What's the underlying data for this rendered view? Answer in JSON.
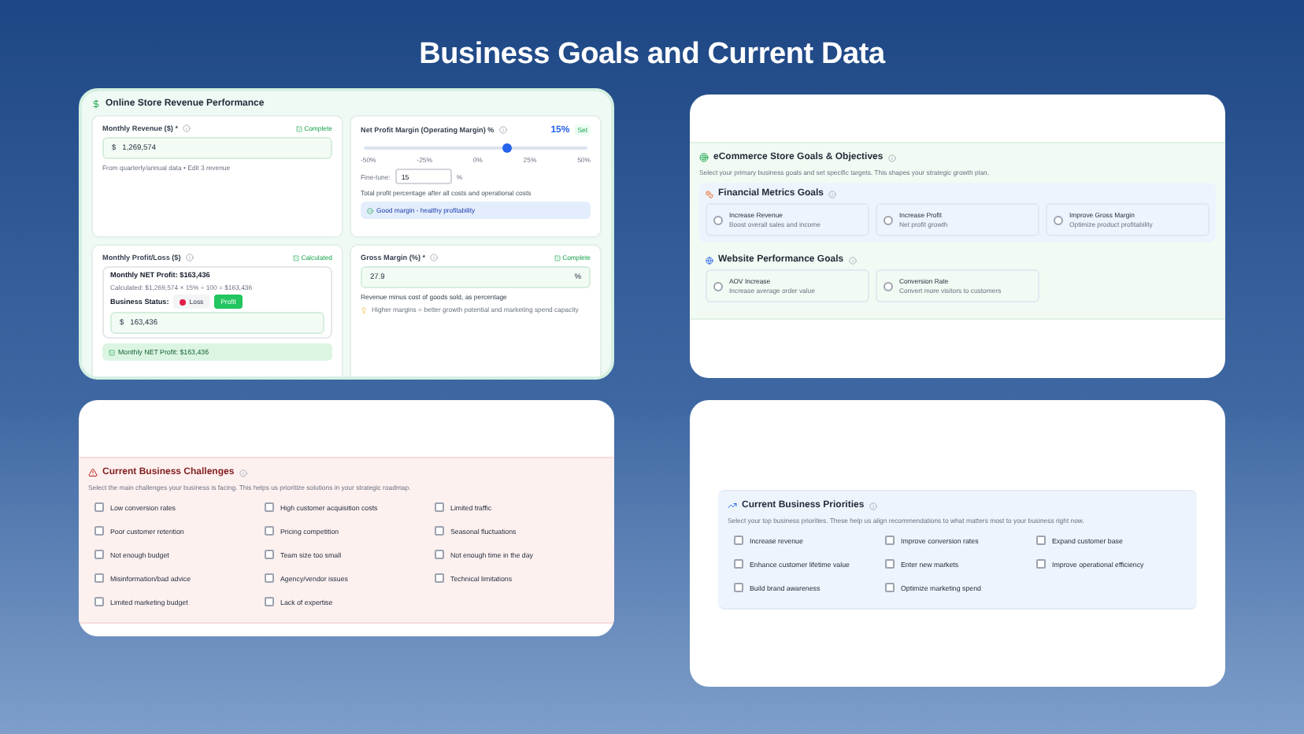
{
  "title": "Business Goals and Current Data",
  "revenue_panel": {
    "title": "Online Store Revenue Performance",
    "monthly_revenue": {
      "label": "Monthly Revenue ($) *",
      "status": "Complete",
      "currency": "$",
      "value": "1,269,574",
      "hint": "From quarterly/annual data • Edit 3 revenue"
    },
    "profit_margin": {
      "label": "Net Profit Margin (Operating Margin) %",
      "reading": "15%",
      "status": "Set",
      "level": 0.64,
      "ticks": [
        "-50%",
        "-25%",
        "0%",
        "25%",
        "50%"
      ],
      "fine_tune_label": "Fine-tune:",
      "fine_tune_value": "15",
      "unit": "%",
      "description": "Total profit percentage after all costs and operational costs",
      "badge": "Good margin - healthy profitability"
    },
    "profit_loss": {
      "label": "Monthly Profit/Loss ($)",
      "status": "Calculated",
      "summary": "Monthly NET Profit: $163,436",
      "formula": "Calculated: $1,269,574 × 15% ÷ 100 = $163,436",
      "status_label": "Business Status:",
      "options": [
        {
          "label": "Loss",
          "selected": false
        },
        {
          "label": "Profit",
          "selected": true
        }
      ],
      "currency": "$",
      "value": "163,436",
      "result": "Monthly NET Profit: $163,436"
    },
    "gross_margin": {
      "label": "Gross Margin (%) *",
      "status": "Complete",
      "value": "27.9",
      "unit": "%",
      "description": "Revenue minus cost of goods sold, as percentage",
      "tip": "Higher margins = better growth potential and marketing spend capacity"
    }
  },
  "goals_panel": {
    "title": "eCommerce Store Goals & Objectives",
    "description": "Select your primary business goals and set specific targets. This shapes your strategic growth plan.",
    "groups": [
      {
        "kind": "financial",
        "title": "Financial Metrics Goals",
        "options": [
          {
            "title": "Increase Revenue",
            "subtitle": "Boost overall sales and income",
            "checked": false
          },
          {
            "title": "Increase Profit",
            "subtitle": "Net profit growth",
            "checked": false
          },
          {
            "title": "Improve Gross Margin",
            "subtitle": "Optimize product profitability",
            "checked": false
          }
        ]
      },
      {
        "kind": "website",
        "title": "Website Performance Goals",
        "options": [
          {
            "title": "AOV Increase",
            "subtitle": "Increase average order value",
            "checked": false
          },
          {
            "title": "Conversion Rate",
            "subtitle": "Convert more visitors to customers",
            "checked": false
          }
        ]
      }
    ]
  },
  "challenges": {
    "title": "Current Business Challenges",
    "description": "Select the main challenges your business is facing. This helps us prioritize solutions in your strategic roadmap.",
    "items": [
      {
        "label": "Low conversion rates",
        "checked": false
      },
      {
        "label": "High customer acquisition costs",
        "checked": false
      },
      {
        "label": "Limited traffic",
        "checked": false
      },
      {
        "label": "Poor customer retention",
        "checked": false
      },
      {
        "label": "Pricing competition",
        "checked": false
      },
      {
        "label": "Seasonal fluctuations",
        "checked": false
      },
      {
        "label": "Not enough budget",
        "checked": false
      },
      {
        "label": "Team size too small",
        "checked": false
      },
      {
        "label": "Not enough time in the day",
        "checked": false
      },
      {
        "label": "Misinformation/bad advice",
        "checked": false
      },
      {
        "label": "Agency/vendor issues",
        "checked": false
      },
      {
        "label": "Technical limitations",
        "checked": false
      },
      {
        "label": "Limited marketing budget",
        "checked": false
      },
      {
        "label": "Lack of expertise",
        "checked": false
      }
    ]
  },
  "priorities": {
    "title": "Current Business Priorities",
    "description": "Select your top business priorities. These help us align recommendations to what matters most to your business right now.",
    "items": [
      {
        "label": "Increase revenue",
        "checked": false
      },
      {
        "label": "Improve conversion rates",
        "checked": false
      },
      {
        "label": "Expand customer base",
        "checked": false
      },
      {
        "label": "Enhance customer lifetime value",
        "checked": false
      },
      {
        "label": "Enter new markets",
        "checked": false
      },
      {
        "label": "Improve operational efficiency",
        "checked": false
      },
      {
        "label": "Build brand awareness",
        "checked": false
      },
      {
        "label": "Optimize marketing spend",
        "checked": false
      }
    ]
  }
}
